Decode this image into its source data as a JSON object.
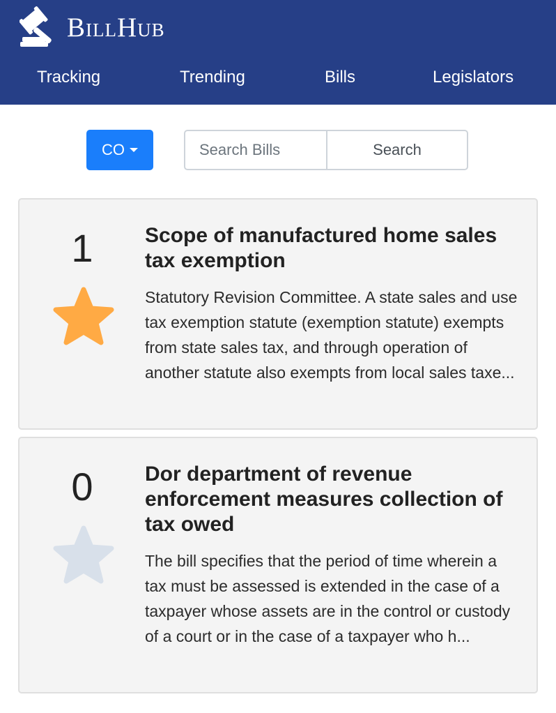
{
  "header": {
    "brand": "BillHub",
    "logo_icon": "gavel-icon",
    "nav": [
      "Tracking",
      "Trending",
      "Bills",
      "Legislators"
    ]
  },
  "toolbar": {
    "state": "CO",
    "search_placeholder": "Search Bills",
    "search_value": "",
    "search_label": "Search"
  },
  "colors": {
    "navbar": "#263f87",
    "primary_button": "#1a7efb",
    "star_active": "#ffaa44",
    "star_inactive": "#d8e0ea",
    "card_bg": "#f4f4f4"
  },
  "bills": [
    {
      "votes": "1",
      "starred": true,
      "star_icon": "star-icon-filled",
      "title": "Scope of manufactured home sales tax exemption",
      "description": "Statutory Revision Committee. A state sales and use tax exemption statute (exemption statute) exempts from state sales tax, and through operation of another statute also exempts from local sales taxe..."
    },
    {
      "votes": "0",
      "starred": false,
      "star_icon": "star-icon-empty",
      "title": "Dor department of revenue enforcement measures collection of tax owed",
      "description": "The bill specifies that the period of time wherein a tax must be assessed is extended in the case of a taxpayer whose assets are in the control or custody of a court or in the case of a taxpayer who h..."
    }
  ]
}
